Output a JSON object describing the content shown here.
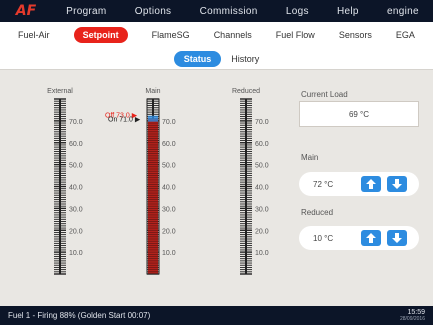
{
  "app": {
    "logo": "AF"
  },
  "topnav": [
    {
      "id": "program",
      "label": "Program"
    },
    {
      "id": "options",
      "label": "Options"
    },
    {
      "id": "commission",
      "label": "Commission"
    },
    {
      "id": "logs",
      "label": "Logs"
    },
    {
      "id": "help",
      "label": "Help"
    },
    {
      "id": "engineer",
      "label": "engine"
    }
  ],
  "subnav": [
    {
      "id": "fuel-air",
      "label": "Fuel-Air",
      "active": false
    },
    {
      "id": "setpoint",
      "label": "Setpoint",
      "active": true
    },
    {
      "id": "flamesg",
      "label": "FlameSG",
      "active": false
    },
    {
      "id": "channels",
      "label": "Channels",
      "active": false
    },
    {
      "id": "fuel-flow",
      "label": "Fuel Flow",
      "active": false
    },
    {
      "id": "sensors",
      "label": "Sensors",
      "active": false
    },
    {
      "id": "ega",
      "label": "EGA",
      "active": false
    }
  ],
  "view_toggle": {
    "status": "Status",
    "history": "History",
    "active": "status"
  },
  "gauges": {
    "scale": {
      "min": 0,
      "max": 80,
      "labels": [
        70.0,
        60.0,
        50.0,
        40.0,
        30.0,
        20.0,
        10.0
      ],
      "label_text": [
        "70.0",
        "60.0",
        "50.0",
        "40.0",
        "30.0",
        "20.0",
        "10.0"
      ]
    },
    "external": {
      "title": "External"
    },
    "main": {
      "title": "Main",
      "fill_top_value": 71.0,
      "off_marker": {
        "label": "Off 73.0",
        "value": 73.0,
        "color": "#e8231b"
      },
      "on_marker": {
        "label": "On 71.0",
        "value": 71.0,
        "color": "#222222"
      }
    },
    "reduced": {
      "title": "Reduced"
    }
  },
  "right_panel": {
    "current_load_label": "Current Load",
    "current_load_value": "69 °C",
    "main_label": "Main",
    "main_value": "72 °C",
    "reduced_label": "Reduced",
    "reduced_value": "10 °C"
  },
  "status": {
    "message": "Fuel 1 - Firing 88% (Golden Start 00:07)",
    "time": "15:59",
    "date": "28/09/2016"
  },
  "colors": {
    "nav_bg": "#0c1528",
    "accent_red": "#e8231b",
    "accent_blue": "#2d8ce0",
    "gauge_red": "#b3221c"
  }
}
